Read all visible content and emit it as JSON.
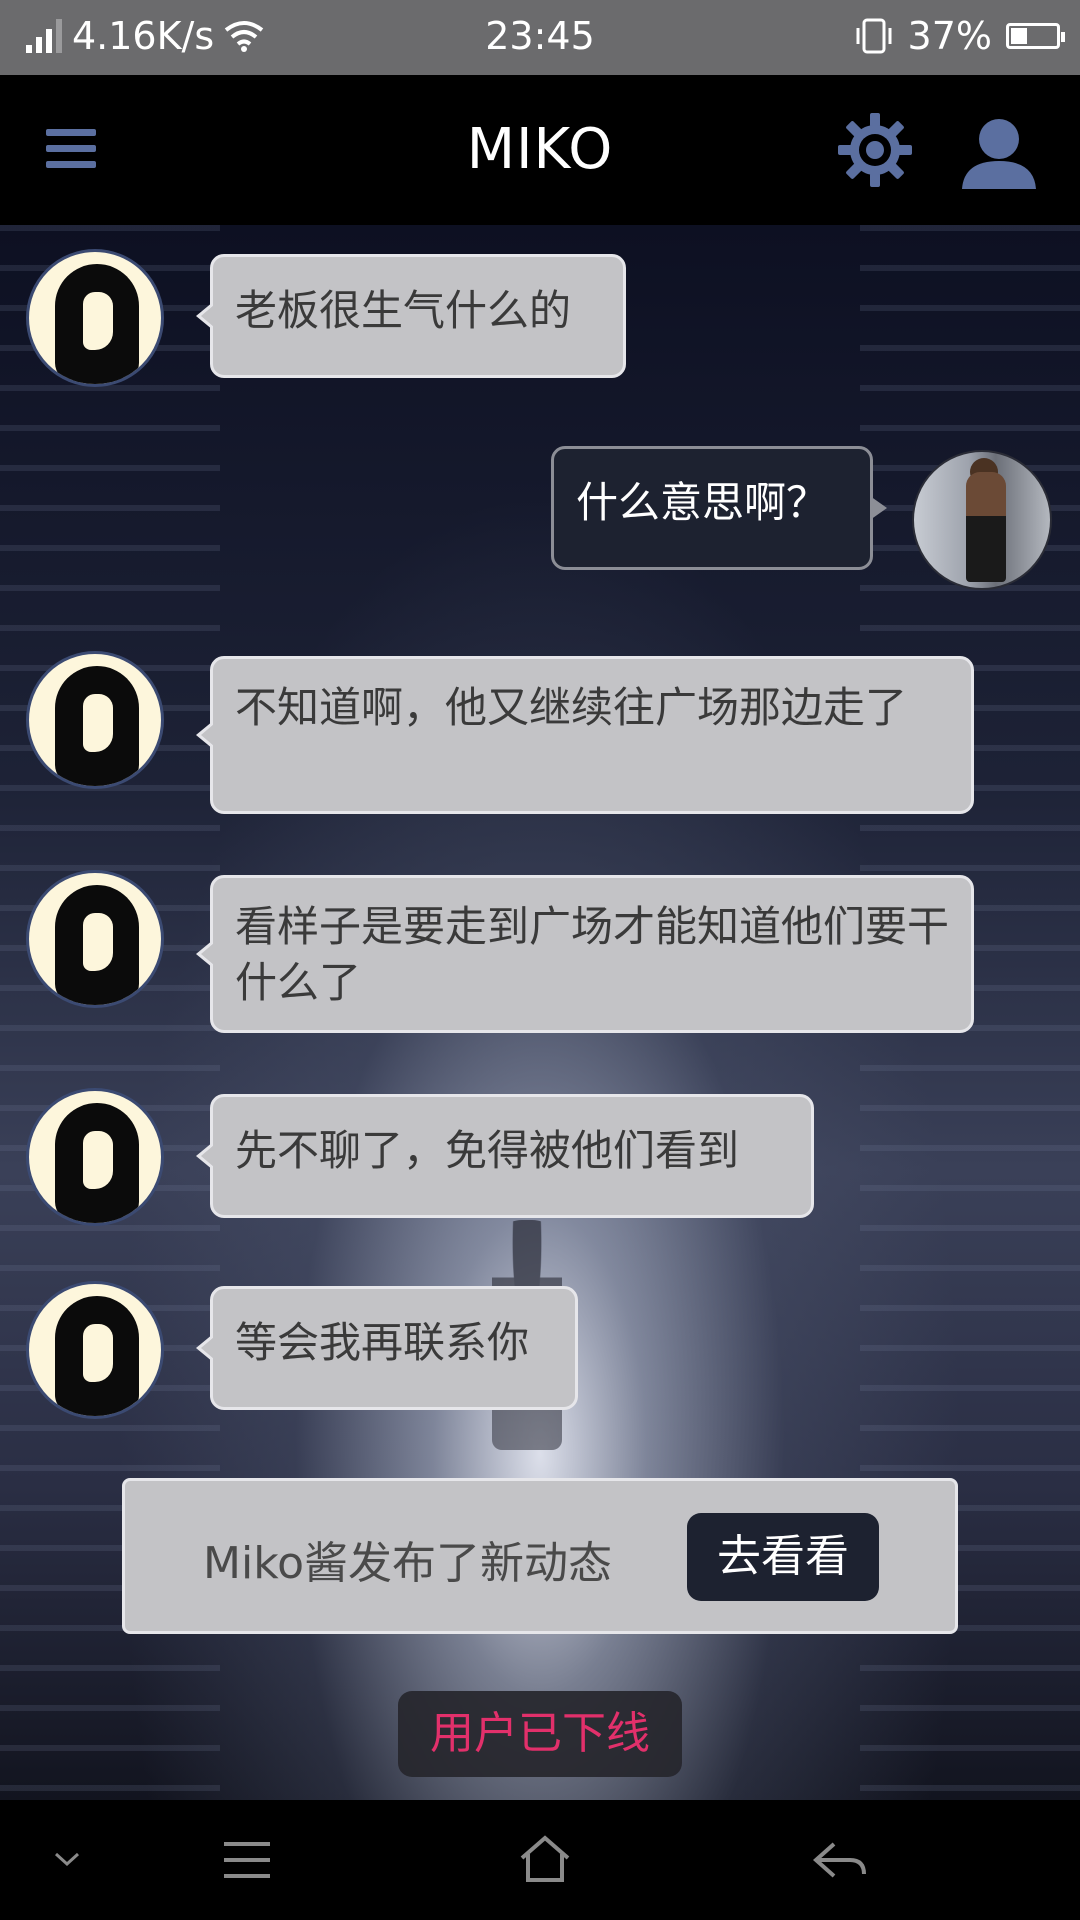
{
  "status_bar": {
    "speed": "4.16K/s",
    "time": "23:45",
    "battery": "37%",
    "battery_level": 0.37
  },
  "app_bar": {
    "title": "MIKO"
  },
  "messages": [
    {
      "side": "in",
      "text": "老板很生气什么的"
    },
    {
      "side": "out",
      "text": "什么意思啊？"
    },
    {
      "side": "in",
      "text": "不知道啊，他又继续往广场那边走了"
    },
    {
      "side": "in",
      "text": "看样子是要走到广场才能知道他们要干什么了"
    },
    {
      "side": "in",
      "text": "先不聊了，免得被他们看到"
    },
    {
      "side": "in",
      "text": "等会我再联系你"
    }
  ],
  "notice": {
    "text": "Miko酱发布了新动态",
    "button_label": "去看看"
  },
  "offline_status": "用户已下线",
  "colors": {
    "accent_icon": "#5b6fa0",
    "offline_text": "#e2306b",
    "bubble_in": "#c3c3c6",
    "bubble_out": "#1d2230"
  },
  "nav_icons": [
    "chevron-down-icon",
    "menu-icon",
    "home-icon",
    "back-icon"
  ]
}
